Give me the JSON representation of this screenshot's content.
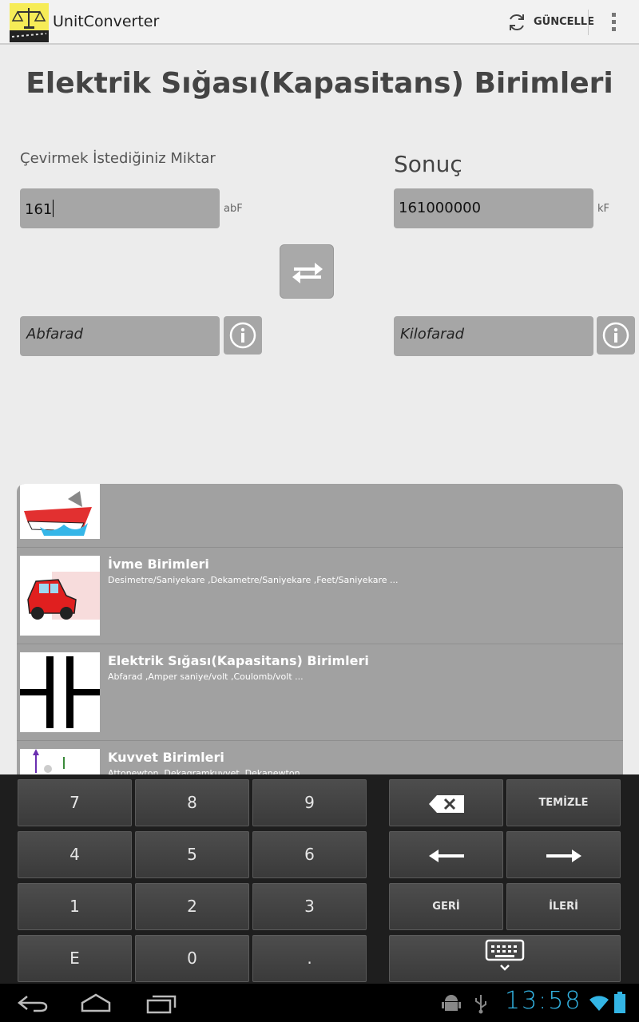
{
  "app": {
    "title": "UnitConverter"
  },
  "actionbar": {
    "update_label": "GÜNCELLE"
  },
  "page": {
    "title": "Elektrik Sığası(Kapasitans) Birimleri"
  },
  "converter": {
    "input_label": "Çevirmek İstediğiniz Miktar",
    "result_label": "Sonuç",
    "input_value": "161",
    "result_value": "161000000",
    "input_unit_abbr": "abF",
    "result_unit_abbr": "kF",
    "from_unit": "Abfarad",
    "to_unit": "Kilofarad"
  },
  "categories": [
    {
      "title": "",
      "subtitle": "",
      "icon": "boat-icon"
    },
    {
      "title": "İvme Birimleri",
      "subtitle": "Desimetre/Saniyekare ,Dekametre/Saniyekare ,Feet/Saniyekare ...",
      "icon": "car-icon"
    },
    {
      "title": "Elektrik Sığası(Kapasitans) Birimleri",
      "subtitle": "Abfarad ,Amper saniye/volt ,Coulomb/volt ...",
      "icon": "capacitor-icon"
    },
    {
      "title": "Kuvvet Birimleri",
      "subtitle": "Attonewton ,Dekagramkuvvet ,Dekanewton ...",
      "icon": "force-icon"
    }
  ],
  "keypad": {
    "k7": "7",
    "k8": "8",
    "k9": "9",
    "k4": "4",
    "k5": "5",
    "k6": "6",
    "k1": "1",
    "k2": "2",
    "k3": "3",
    "kE": "E",
    "k0": "0",
    "kdot": ".",
    "clear": "TEMİZLE",
    "back": "GERİ",
    "next": "İLERİ"
  },
  "statusbar": {
    "time": "13:58"
  },
  "colors": {
    "accent": "#33b5e5",
    "field_bg": "#a6a6a6",
    "keypad_bg": "#1e1e1e"
  }
}
